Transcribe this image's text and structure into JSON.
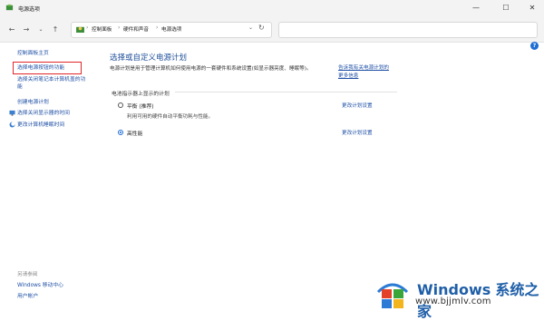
{
  "window": {
    "title": "电源选项",
    "minimize_glyph": "—",
    "maximize_glyph": "☐",
    "close_glyph": "✕"
  },
  "address_bar": {
    "back_glyph": "←",
    "forward_glyph": "→",
    "recent_glyph": "⌄",
    "up_glyph": "↑",
    "crumbs": [
      "控制面板",
      "硬件和声音",
      "电源选项"
    ],
    "separator": "›",
    "dropdown_glyph": "⌄",
    "refresh_glyph": "↻"
  },
  "sidebar": {
    "items": [
      {
        "label": "控制面板主页"
      },
      {
        "label": "选择电源按钮的功能"
      },
      {
        "label": "选择关闭笔记本计算机盖的功"
      },
      {
        "label": "能"
      },
      {
        "label": "创建电源计划"
      },
      {
        "label": "选择关闭显示器的时间"
      },
      {
        "label": "更改计算机睡眠时间"
      }
    ],
    "see_also": {
      "heading": "另请参阅",
      "items": [
        {
          "label": "Windows 移动中心"
        },
        {
          "label": "用户帐户"
        }
      ]
    }
  },
  "main": {
    "heading": "选择或自定义电源计划",
    "description": "电源计划是用于管理计算机如何使用电源的一套硬件和系统设置(如显示器亮度、睡眠等)。",
    "description_link": "告诉我有关电源计划的更多信息",
    "group_label": "电池指示器上显示的计划",
    "plans": [
      {
        "name": "平衡 (推荐)",
        "description": "利用可用的硬件自动平衡功耗与性能。",
        "link": "更改计划设置",
        "selected": false
      },
      {
        "name": "高性能",
        "description": "",
        "link": "更改计划设置",
        "selected": true
      }
    ]
  },
  "help": {
    "glyph": "?"
  },
  "watermark": {
    "brand": "Windows",
    "site_name": "系统之家",
    "url": "www.bjjmlv.com"
  }
}
